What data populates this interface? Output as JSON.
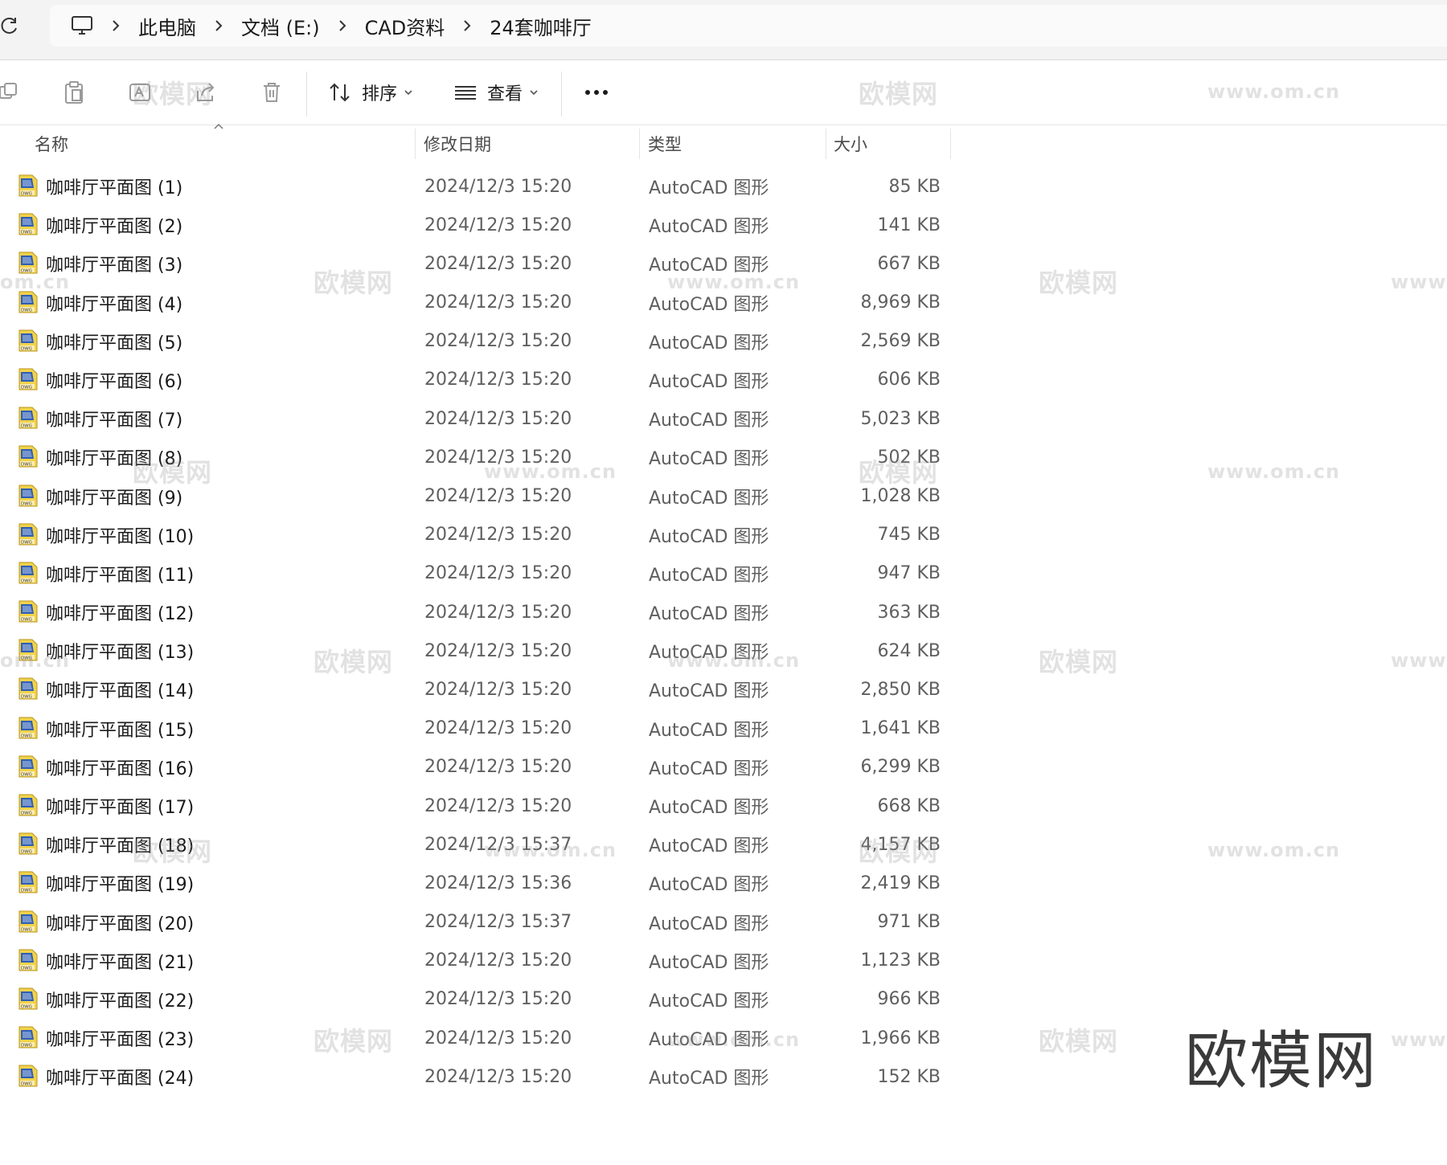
{
  "address_bar": {
    "breadcrumbs": [
      "此电脑",
      "文档 (E:)",
      "CAD资料",
      "24套咖啡厅"
    ]
  },
  "toolbar": {
    "sort_label": "排序",
    "view_label": "查看"
  },
  "columns": {
    "name": "名称",
    "date": "修改日期",
    "type": "类型",
    "size": "大小"
  },
  "files": [
    {
      "name": "咖啡厅平面图 (1)",
      "date": "2024/12/3 15:20",
      "type": "AutoCAD 图形",
      "size": "85 KB"
    },
    {
      "name": "咖啡厅平面图 (2)",
      "date": "2024/12/3 15:20",
      "type": "AutoCAD 图形",
      "size": "141 KB"
    },
    {
      "name": "咖啡厅平面图 (3)",
      "date": "2024/12/3 15:20",
      "type": "AutoCAD 图形",
      "size": "667 KB"
    },
    {
      "name": "咖啡厅平面图 (4)",
      "date": "2024/12/3 15:20",
      "type": "AutoCAD 图形",
      "size": "8,969 KB"
    },
    {
      "name": "咖啡厅平面图 (5)",
      "date": "2024/12/3 15:20",
      "type": "AutoCAD 图形",
      "size": "2,569 KB"
    },
    {
      "name": "咖啡厅平面图 (6)",
      "date": "2024/12/3 15:20",
      "type": "AutoCAD 图形",
      "size": "606 KB"
    },
    {
      "name": "咖啡厅平面图 (7)",
      "date": "2024/12/3 15:20",
      "type": "AutoCAD 图形",
      "size": "5,023 KB"
    },
    {
      "name": "咖啡厅平面图 (8)",
      "date": "2024/12/3 15:20",
      "type": "AutoCAD 图形",
      "size": "502 KB"
    },
    {
      "name": "咖啡厅平面图 (9)",
      "date": "2024/12/3 15:20",
      "type": "AutoCAD 图形",
      "size": "1,028 KB"
    },
    {
      "name": "咖啡厅平面图 (10)",
      "date": "2024/12/3 15:20",
      "type": "AutoCAD 图形",
      "size": "745 KB"
    },
    {
      "name": "咖啡厅平面图 (11)",
      "date": "2024/12/3 15:20",
      "type": "AutoCAD 图形",
      "size": "947 KB"
    },
    {
      "name": "咖啡厅平面图 (12)",
      "date": "2024/12/3 15:20",
      "type": "AutoCAD 图形",
      "size": "363 KB"
    },
    {
      "name": "咖啡厅平面图 (13)",
      "date": "2024/12/3 15:20",
      "type": "AutoCAD 图形",
      "size": "624 KB"
    },
    {
      "name": "咖啡厅平面图 (14)",
      "date": "2024/12/3 15:20",
      "type": "AutoCAD 图形",
      "size": "2,850 KB"
    },
    {
      "name": "咖啡厅平面图 (15)",
      "date": "2024/12/3 15:20",
      "type": "AutoCAD 图形",
      "size": "1,641 KB"
    },
    {
      "name": "咖啡厅平面图 (16)",
      "date": "2024/12/3 15:20",
      "type": "AutoCAD 图形",
      "size": "6,299 KB"
    },
    {
      "name": "咖啡厅平面图 (17)",
      "date": "2024/12/3 15:20",
      "type": "AutoCAD 图形",
      "size": "668 KB"
    },
    {
      "name": "咖啡厅平面图 (18)",
      "date": "2024/12/3 15:37",
      "type": "AutoCAD 图形",
      "size": "4,157 KB"
    },
    {
      "name": "咖啡厅平面图 (19)",
      "date": "2024/12/3 15:36",
      "type": "AutoCAD 图形",
      "size": "2,419 KB"
    },
    {
      "name": "咖啡厅平面图 (20)",
      "date": "2024/12/3 15:37",
      "type": "AutoCAD 图形",
      "size": "971 KB"
    },
    {
      "name": "咖啡厅平面图 (21)",
      "date": "2024/12/3 15:20",
      "type": "AutoCAD 图形",
      "size": "1,123 KB"
    },
    {
      "name": "咖啡厅平面图 (22)",
      "date": "2024/12/3 15:20",
      "type": "AutoCAD 图形",
      "size": "966 KB"
    },
    {
      "name": "咖啡厅平面图 (23)",
      "date": "2024/12/3 15:20",
      "type": "AutoCAD 图形",
      "size": "1,966 KB"
    },
    {
      "name": "咖啡厅平面图 (24)",
      "date": "2024/12/3 15:20",
      "type": "AutoCAD 图形",
      "size": "152 KB"
    }
  ],
  "watermark": {
    "logo_text": "欧模网",
    "url_text": "www.om.cn",
    "url_partial": "om.cn"
  },
  "icons": {
    "refresh": "refresh-icon",
    "computer": "computer-icon",
    "crumb_separator": "chevron-right-icon",
    "file": "dwg-file-icon"
  }
}
